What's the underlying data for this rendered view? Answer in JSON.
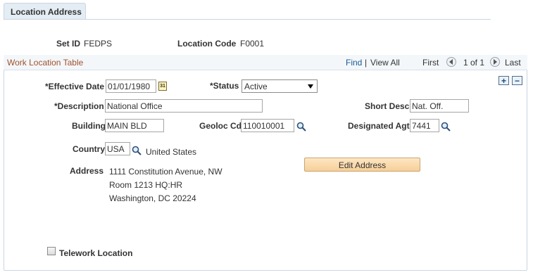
{
  "tab": {
    "label": "Location Address"
  },
  "header": {
    "setid_label": "Set ID",
    "setid_value": "FEDPS",
    "location_code_label": "Location Code",
    "location_code_value": "F0001"
  },
  "grid": {
    "title": "Work Location Table",
    "find": "Find",
    "separator": "|",
    "view_all": "View All",
    "first": "First",
    "count": "1 of 1",
    "last": "Last"
  },
  "form": {
    "effdt_label": "*Effective Date",
    "effdt_value": "01/01/1980",
    "status_label": "*Status",
    "status_value": "Active",
    "description_label": "*Description",
    "description_value": "National Office",
    "short_desc_label": "Short Desc",
    "short_desc_value": "Nat. Off.",
    "building_label": "Building",
    "building_value": "MAIN BLD",
    "geoloc_label": "Geoloc Cd",
    "geoloc_value": "110010001",
    "desig_agt_label": "Designated Agt",
    "desig_agt_value": "7441",
    "country_label": "Country",
    "country_value": "USA",
    "country_desc": "United States",
    "address_label": "Address",
    "address_lines": [
      "1111 Constitution Avenue, NW",
      "Room 1213 HQ:HR",
      "Washington, DC 20224"
    ],
    "edit_address_button": "Edit Address",
    "telework_label": "Telework Location",
    "calendar_icon_text": "31",
    "add_row": "+",
    "delete_row": "−"
  },
  "colors": {
    "accent": "#1a5a96",
    "grid_title": "#a0522d",
    "button": "#f7cf97"
  },
  "icons": [
    "calendar-icon",
    "search-icon",
    "first-arrow-icon",
    "last-arrow-icon",
    "add-row-icon",
    "delete-row-icon",
    "dropdown-arrow-icon"
  ]
}
